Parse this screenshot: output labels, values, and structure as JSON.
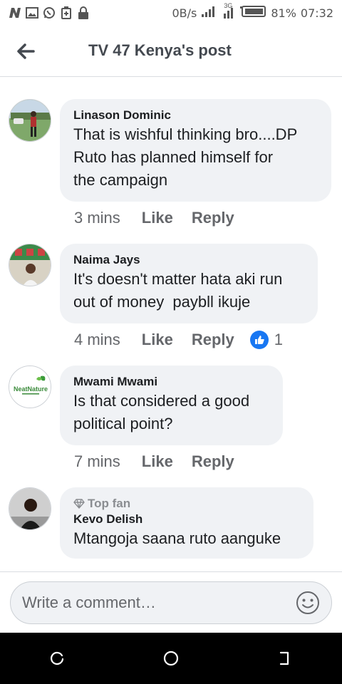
{
  "status_bar": {
    "left_icons": [
      "n-icon",
      "gallery-icon",
      "whatsapp-icon",
      "battery-saver-icon",
      "lock-icon"
    ],
    "data_speed": "0B/s",
    "network": "3G",
    "battery": "81%",
    "time": "07:32"
  },
  "header": {
    "title": "TV 47 Kenya's post",
    "back_icon": "arrow-left-icon"
  },
  "comments": [
    {
      "author": "Linason Dominic",
      "lines": [
        "That is wishful thinking bro....DP",
        "Ruto has planned himself for",
        "the campaign"
      ],
      "time": "3 mins",
      "like_label": "Like",
      "reply_label": "Reply",
      "reactions": null
    },
    {
      "author": "Naima Jays",
      "lines": [
        "It's doesn't matter hata aki run",
        "out of money  paybll ikuje"
      ],
      "time": "4 mins",
      "like_label": "Like",
      "reply_label": "Reply",
      "reactions": "1"
    },
    {
      "author": "Mwami Mwami",
      "lines": [
        "Is that considered a good",
        "political point?"
      ],
      "time": "7 mins",
      "like_label": "Like",
      "reply_label": "Reply",
      "reactions": null
    },
    {
      "badge": "Top fan",
      "author": "Kevo Delish",
      "lines": [
        "Mtangoja saana ruto aanguke"
      ],
      "time": null
    }
  ],
  "avatar_3_logo_text": "NeatNature",
  "composer": {
    "placeholder": "Write a comment…"
  },
  "colors": {
    "bubble": "#f0f2f5",
    "meta": "#65676b",
    "like_blue": "#1877f2"
  }
}
